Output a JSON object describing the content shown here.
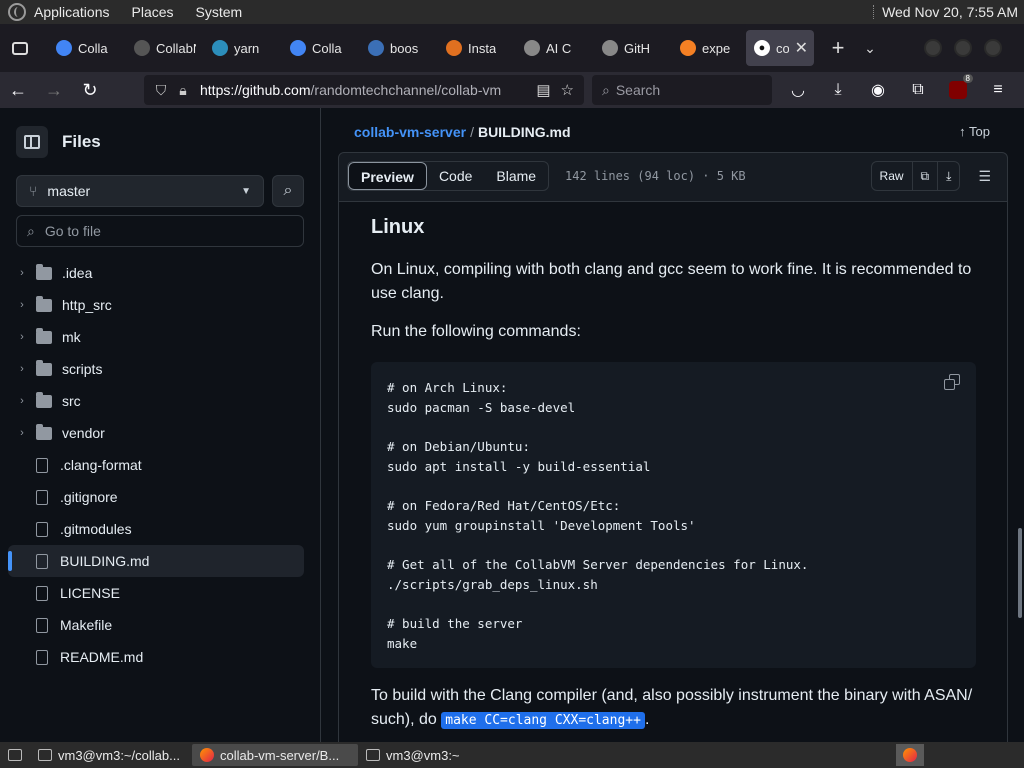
{
  "system": {
    "menus": [
      "Applications",
      "Places",
      "System"
    ],
    "datetime": "Wed Nov 20,  7:55 AM"
  },
  "tabs": [
    {
      "label": "Colla",
      "icon": "search-icon",
      "color": "#4285f4"
    },
    {
      "label": "CollabN",
      "icon": "page-icon",
      "color": "#555"
    },
    {
      "label": "yarn",
      "icon": "yarn-icon",
      "color": "#2c8ebb"
    },
    {
      "label": "Colla",
      "icon": "search-icon",
      "color": "#4285f4"
    },
    {
      "label": "boos",
      "icon": "boost-icon",
      "color": "#3b6fb6"
    },
    {
      "label": "Insta",
      "icon": "magnifier-icon",
      "color": "#e07020"
    },
    {
      "label": "AI C",
      "icon": "openai-icon",
      "color": "#888"
    },
    {
      "label": "GitH",
      "icon": "github-icon",
      "color": "#888"
    },
    {
      "label": "expe",
      "icon": "stackoverflow-icon",
      "color": "#f48024"
    }
  ],
  "active_tab": {
    "label": "co",
    "icon": "github-icon"
  },
  "navbar": {
    "url_domain": "https://github.com",
    "url_rest": "/randomtechchannel/collab-vm",
    "search_placeholder": "Search",
    "ublock_badge": "8"
  },
  "sidebar": {
    "title": "Files",
    "branch": "master",
    "goto_placeholder": "Go to file",
    "items": [
      {
        "name": ".idea",
        "type": "folder"
      },
      {
        "name": "http_src",
        "type": "folder"
      },
      {
        "name": "mk",
        "type": "folder"
      },
      {
        "name": "scripts",
        "type": "folder"
      },
      {
        "name": "src",
        "type": "folder"
      },
      {
        "name": "vendor",
        "type": "folder"
      },
      {
        "name": ".clang-format",
        "type": "file"
      },
      {
        "name": ".gitignore",
        "type": "file"
      },
      {
        "name": ".gitmodules",
        "type": "file"
      },
      {
        "name": "BUILDING.md",
        "type": "file",
        "active": true
      },
      {
        "name": "LICENSE",
        "type": "file"
      },
      {
        "name": "Makefile",
        "type": "file"
      },
      {
        "name": "README.md",
        "type": "file"
      }
    ]
  },
  "file": {
    "repo": "collab-vm-server",
    "separator": "/",
    "name": "BUILDING.md",
    "top_label": "Top",
    "tabs": [
      "Preview",
      "Code",
      "Blame"
    ],
    "meta": "142 lines (94 loc) · 5 KB",
    "raw_label": "Raw"
  },
  "markdown": {
    "heading": "Linux",
    "para1": "On Linux, compiling with both clang and gcc seem to work fine. It is recommended to use clang.",
    "para2": "Run the following commands:",
    "code": "# on Arch Linux:\nsudo pacman -S base-devel\n\n# on Debian/Ubuntu:\nsudo apt install -y build-essential\n\n# on Fedora/Red Hat/CentOS/Etc:\nsudo yum groupinstall 'Development Tools'\n\n# Get all of the CollabVM Server dependencies for Linux.\n./scripts/grab_deps_linux.sh\n\n# build the server\nmake",
    "para3_start": "To build with the Clang compiler (and, also possibly instrument the binary with ASAN/ such), do ",
    "para3_code": "make CC=clang CXX=clang++",
    "para3_end": "."
  },
  "taskbar": {
    "items": [
      "vm3@vm3:~/collab...",
      "collab-vm-server/B...",
      "vm3@vm3:~"
    ]
  }
}
